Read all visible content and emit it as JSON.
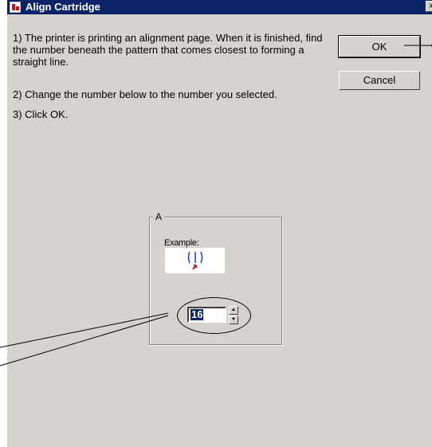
{
  "window": {
    "title": "Align Cartridge",
    "close_glyph": "x"
  },
  "instructions": {
    "step1": "1) The printer is printing an alignment page. When it is finished, find the number beneath the pattern that comes closest to forming a straight line.",
    "step2": "2) Change the number below to the number you selected.",
    "step3": "3) Click OK."
  },
  "buttons": {
    "ok": "OK",
    "cancel": "Cancel"
  },
  "group": {
    "label": "A",
    "example_label": "Example:",
    "value": "16"
  },
  "colors": {
    "titlebar": "#0a246a",
    "dialog_bg": "#d6d3ce",
    "pattern_blue": "#1a3fb5",
    "arrow_red": "#c0171d"
  }
}
